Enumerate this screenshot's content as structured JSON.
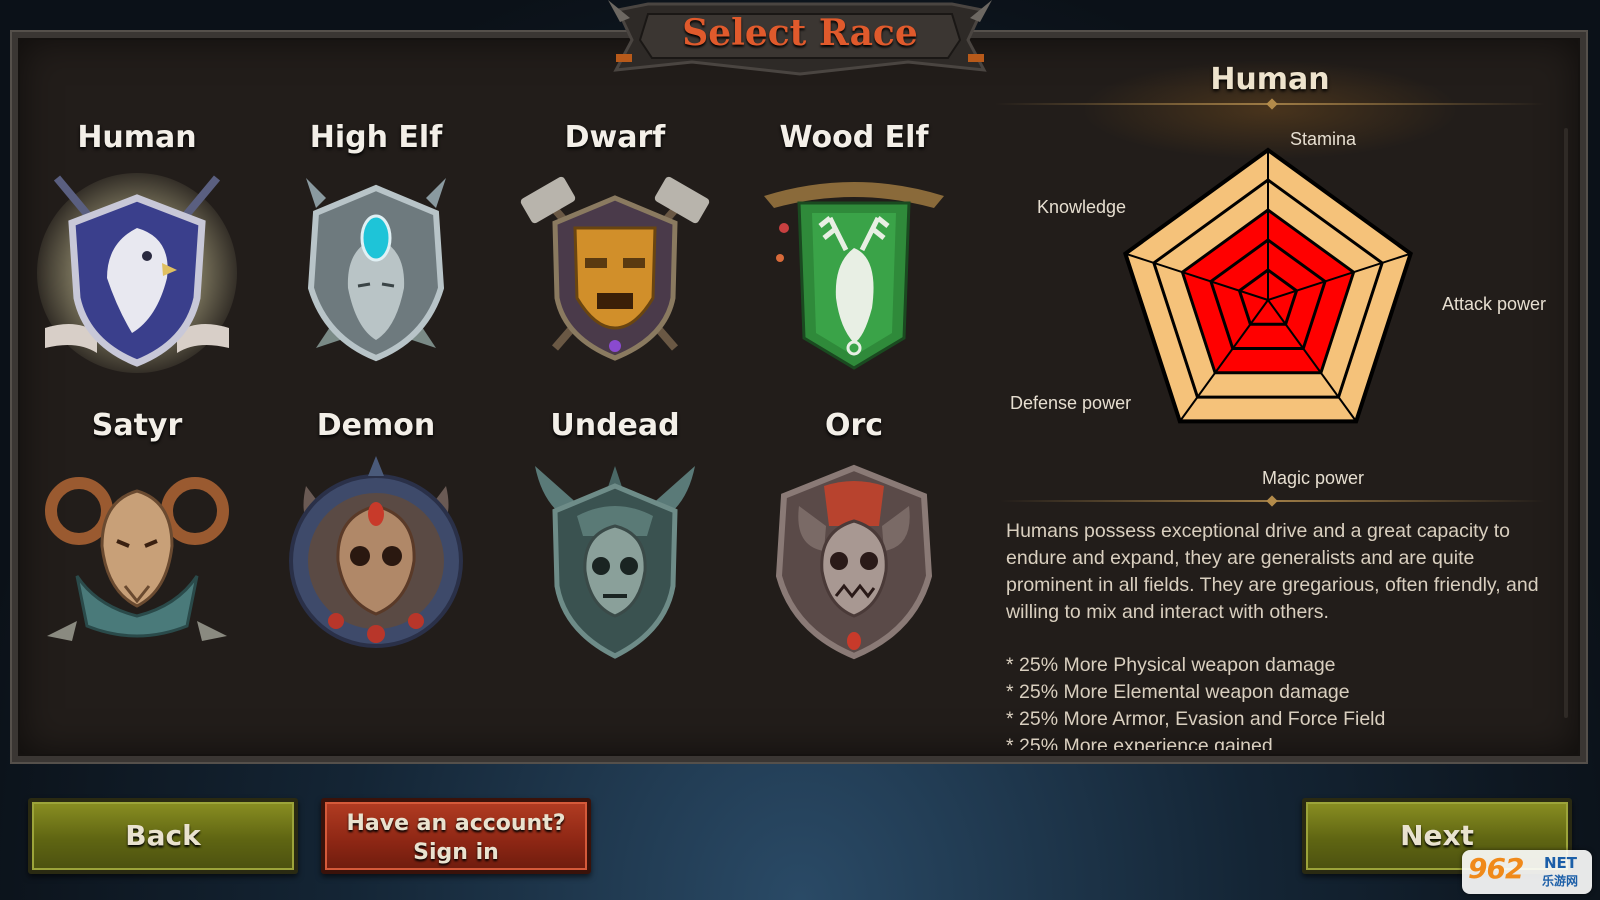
{
  "screen": {
    "title": "Select Race"
  },
  "races": [
    {
      "name": "Human",
      "emblem": "eagle-shield-icon"
    },
    {
      "name": "High Elf",
      "emblem": "elf-mask-icon"
    },
    {
      "name": "Dwarf",
      "emblem": "dwarf-mask-icon"
    },
    {
      "name": "Wood Elf",
      "emblem": "stag-banner-icon"
    },
    {
      "name": "Satyr",
      "emblem": "ram-head-icon"
    },
    {
      "name": "Demon",
      "emblem": "demon-skull-icon"
    },
    {
      "name": "Undead",
      "emblem": "horned-skull-icon"
    },
    {
      "name": "Orc",
      "emblem": "orc-skull-icon"
    }
  ],
  "selected_race": {
    "name": "Human",
    "stats_chart": {
      "axes": [
        "Stamina",
        "Attack power",
        "Magic power",
        "Defense power",
        "Knowledge"
      ],
      "levels": 5,
      "values": [
        3,
        3,
        3,
        3,
        3
      ],
      "max": 5
    },
    "description": "Humans possess exceptional drive and a great capacity to endure and expand, they are generalists and are quite prominent in all fields. They are gregarious, often friendly, and willing to mix and interact with others.",
    "bonuses": [
      "* 25% More Physical weapon damage",
      "* 25% More Elemental weapon damage",
      "* 25% More Armor, Evasion and Force Field",
      "* 25% More experience gained"
    ]
  },
  "buttons": {
    "back": "Back",
    "sign_in_line1": "Have an account?",
    "sign_in_line2": "Sign in",
    "next": "Next"
  },
  "watermark": {
    "logo": "962",
    "net": "NET",
    "cn": "乐游网"
  },
  "colors": {
    "title": "#e05a2c",
    "radar_fill": "#f5c27a",
    "radar_value": "#ff0000",
    "button_green": "#6b7116",
    "button_red": "#9a2c18"
  }
}
